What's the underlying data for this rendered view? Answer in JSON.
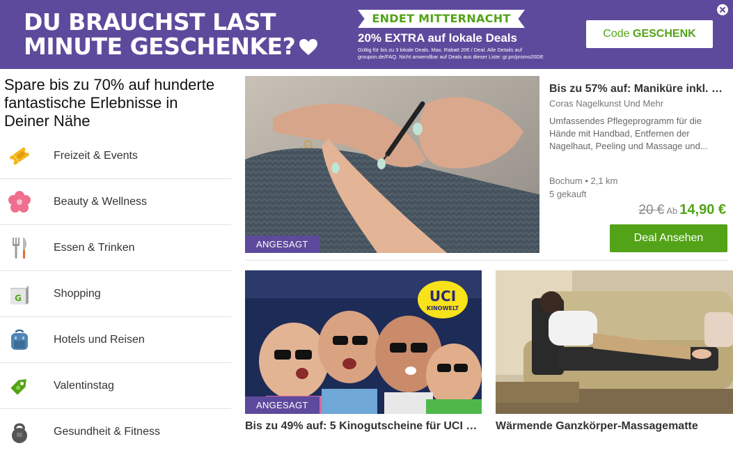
{
  "banner": {
    "headline_line1": "DU BRAUCHST LAST",
    "headline_line2": "MINUTE GESCHENKE?",
    "ribbon": "ENDET MITTERNACHT",
    "promo": "20% EXTRA auf lokale Deals",
    "fine_print": "Gültig für bis zu 3 lokale Deals. Max. Rabatt 20€ / Deal. Alle Details auf groupon.de/FAQ. Nicht anwendbar auf Deals aus dieser Liste: gr.pn/promo20DE",
    "code_prefix": "Code",
    "code_word": "GESCHENK",
    "colors": {
      "background": "#5e4a9c",
      "accent": "#53a318"
    }
  },
  "sidebar": {
    "title": "Spare bis zu 70% auf hunderte fantastische Erlebnisse in Deiner Nähe",
    "categories": [
      {
        "label": "Freizeit & Events",
        "icon": "ticket-icon"
      },
      {
        "label": "Beauty & Wellness",
        "icon": "flower-icon"
      },
      {
        "label": "Essen & Trinken",
        "icon": "fork-knife-icon"
      },
      {
        "label": "Shopping",
        "icon": "shopping-bag-icon"
      },
      {
        "label": "Hotels und Reisen",
        "icon": "backpack-icon"
      },
      {
        "label": "Valentinstag",
        "icon": "tag-icon"
      },
      {
        "label": "Gesundheit & Fitness",
        "icon": "kettlebell-icon"
      }
    ]
  },
  "featured": {
    "badge": "ANGESAGT",
    "title": "Bis zu 57% auf: Maniküre inkl. N...",
    "merchant": "Coras Nagelkunst Und Mehr",
    "description": "Umfassendes Pflegeprogramm für die Hände mit Handbad, Entfernen der Nagelhaut, Peeling und Massage und...",
    "location": "Bochum",
    "distance": "• 2,1 km",
    "bought": "5 gekauft",
    "old_price": "20 €",
    "ab": "Ab",
    "new_price": "14,90 €",
    "button": "Deal Ansehen"
  },
  "deals": [
    {
      "badge": "ANGESAGT",
      "title": "Bis zu 49% auf: 5 Kinogutscheine für UCI Ki...",
      "logo_line1": "UCI",
      "logo_line2": "KINOWELT"
    },
    {
      "title": "Wärmende Ganzkörper-Massagematte"
    }
  ]
}
